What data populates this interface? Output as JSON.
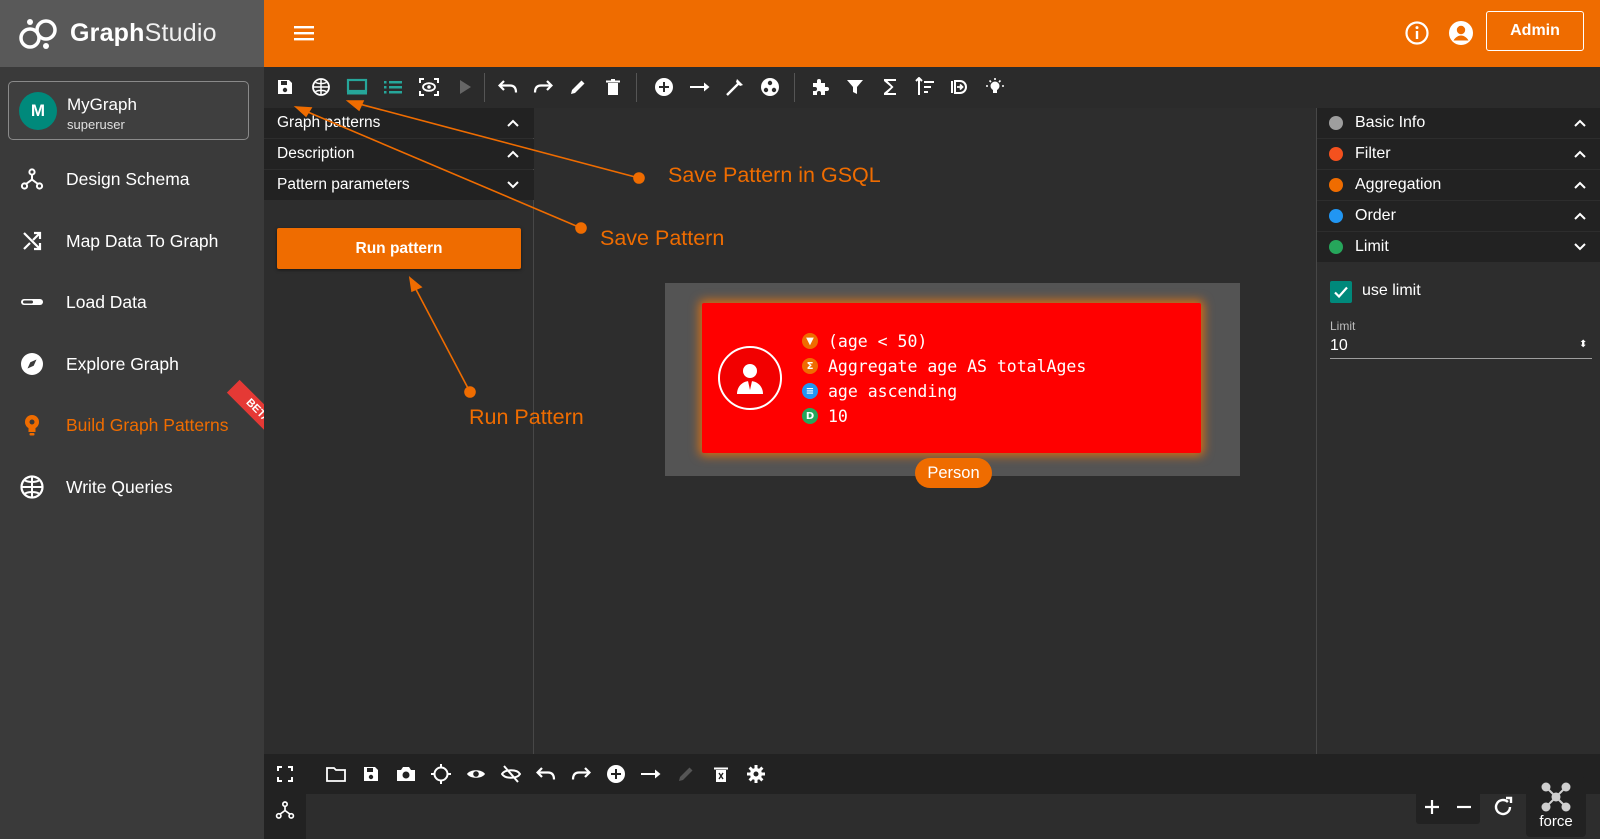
{
  "app": {
    "name_bold": "Graph",
    "name_light": "Studio"
  },
  "header": {
    "admin_label": "Admin"
  },
  "graph": {
    "initial": "M",
    "name": "MyGraph",
    "role": "superuser"
  },
  "nav": [
    {
      "label": "Design Schema",
      "icon": "schema-icon"
    },
    {
      "label": "Map Data To Graph",
      "icon": "shuffle-icon"
    },
    {
      "label": "Load Data",
      "icon": "load-icon"
    },
    {
      "label": "Explore Graph",
      "icon": "compass-icon"
    },
    {
      "label": "Build Graph Patterns",
      "icon": "bulb-icon",
      "active": true
    },
    {
      "label": "Write Queries",
      "icon": "globe-icon"
    }
  ],
  "beta_label": "BETA",
  "left_panel": {
    "sections": [
      {
        "label": "Graph patterns",
        "expanded": false
      },
      {
        "label": "Description",
        "expanded": false
      },
      {
        "label": "Pattern parameters",
        "expanded": true
      }
    ],
    "run_label": "Run pattern"
  },
  "node": {
    "label": "Person",
    "conditions": [
      {
        "icon": "filter-icon",
        "color": "#ef6c00",
        "text": "(age < 50)"
      },
      {
        "icon": "sigma-icon",
        "color": "#ef6c00",
        "text": "Aggregate age AS totalAges"
      },
      {
        "icon": "sort-icon",
        "color": "#2196f3",
        "text": "age ascending"
      },
      {
        "icon": "limit-icon",
        "color": "#26a65b",
        "text": "10"
      }
    ]
  },
  "right_panel": {
    "sections": [
      {
        "label": "Basic Info",
        "color": "#9e9e9e",
        "expanded": false
      },
      {
        "label": "Filter",
        "color": "#f4511e",
        "expanded": false
      },
      {
        "label": "Aggregation",
        "color": "#ef6c00",
        "expanded": false
      },
      {
        "label": "Order",
        "color": "#2196f3",
        "expanded": false
      },
      {
        "label": "Limit",
        "color": "#26a65b",
        "expanded": true
      }
    ],
    "use_limit_label": "use limit",
    "use_limit_checked": true,
    "limit_label": "Limit",
    "limit_value": "10"
  },
  "bottom": {
    "force_label": "force"
  },
  "annotations": {
    "save_gsql": "Save Pattern in GSQL",
    "save_pattern": "Save Pattern",
    "run_pattern": "Run Pattern"
  },
  "colors": {
    "accent": "#ef6c00",
    "sidebar": "#3a3a3a",
    "node": "#ff0000"
  }
}
